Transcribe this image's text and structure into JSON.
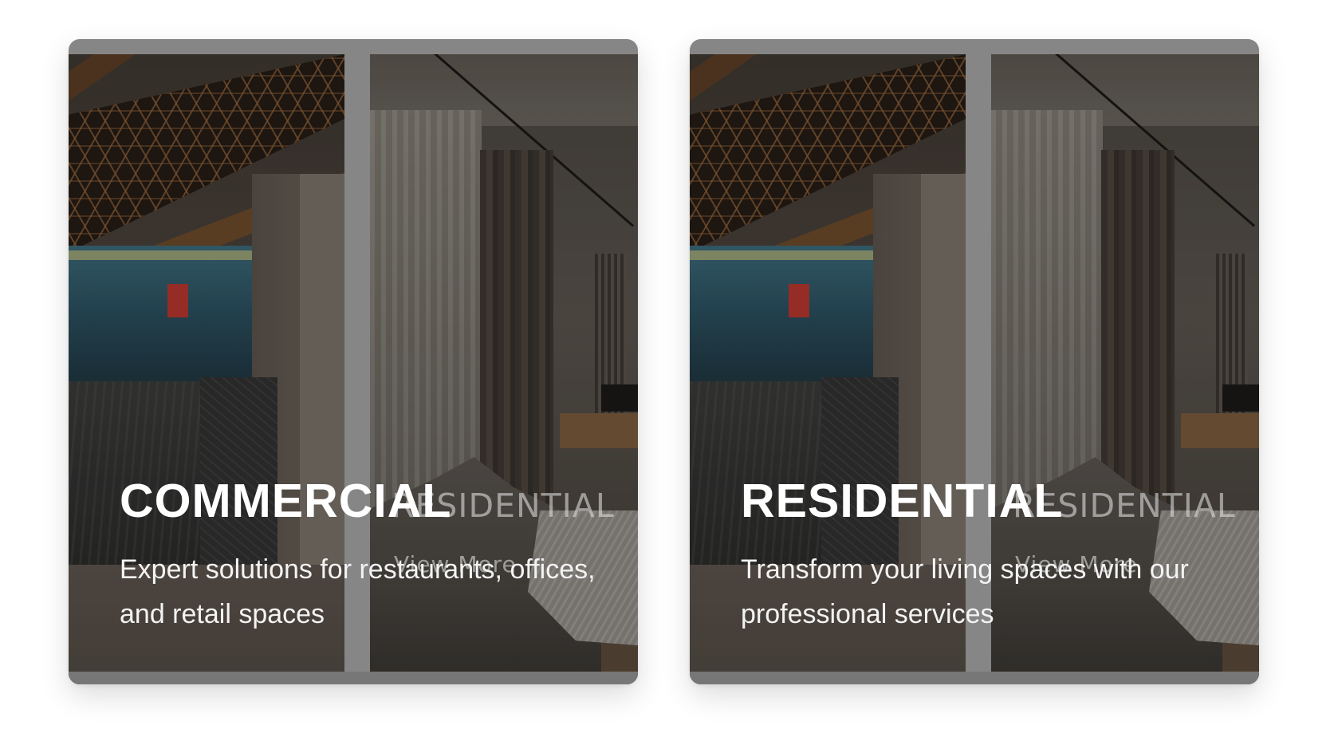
{
  "cards": [
    {
      "title": "COMMERCIAL",
      "description": "Expert solutions for restaurants, offices, and retail spaces",
      "ghost_title": "RESIDENTIAL",
      "ghost_link": "View More"
    },
    {
      "title": "RESIDENTIAL",
      "description": "Transform your living spaces with our professional services",
      "ghost_title": "RESIDENTIAL",
      "ghost_link": "View More"
    }
  ]
}
